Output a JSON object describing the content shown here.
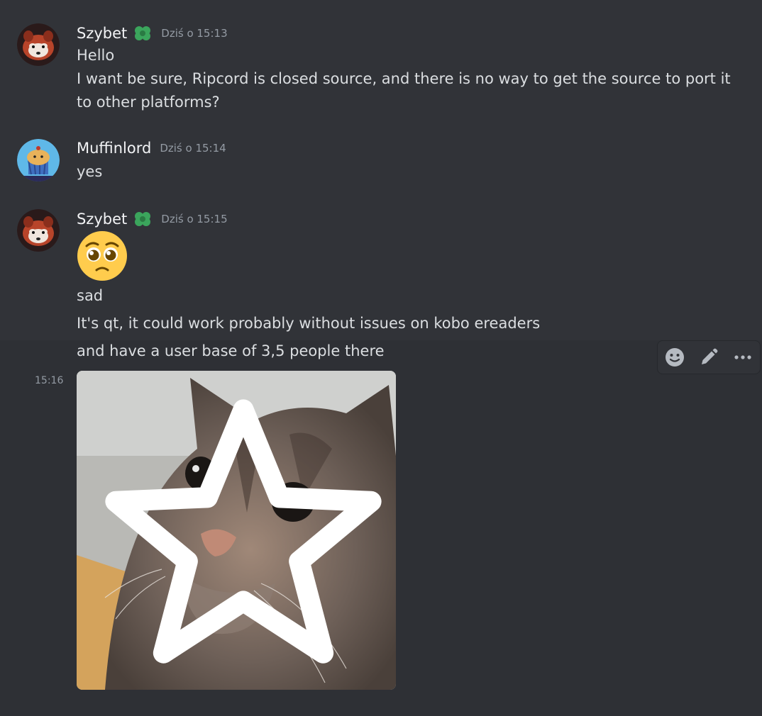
{
  "messages": [
    {
      "author": "Szybet",
      "timestamp": "Dziś o 15:13",
      "lines": [
        "Hello",
        "I want be sure, Ripcord is closed source, and there is no way to get the source to port it",
        "to other platforms?"
      ]
    },
    {
      "author": "Muffinlord",
      "timestamp": "Dziś o 15:14",
      "lines": [
        "yes"
      ]
    },
    {
      "author": "Szybet",
      "timestamp": "Dziś o 15:15",
      "emoji": "pleading-face-emoji",
      "lines": [
        "sad",
        "It's qt, it could work probably without issues on kobo ereaders",
        "and have a user base of 3,5 people there"
      ]
    }
  ],
  "attachment": {
    "side_time": "15:16",
    "description_icon": "cat-photo"
  },
  "toolbar": {
    "icons": [
      "add-reaction-icon",
      "edit-icon",
      "more-icon"
    ]
  },
  "colors": {
    "background": "#313338",
    "hover_background": "#2e3035",
    "role_icon": "#3ba55c",
    "timestamp": "#949ba4"
  }
}
